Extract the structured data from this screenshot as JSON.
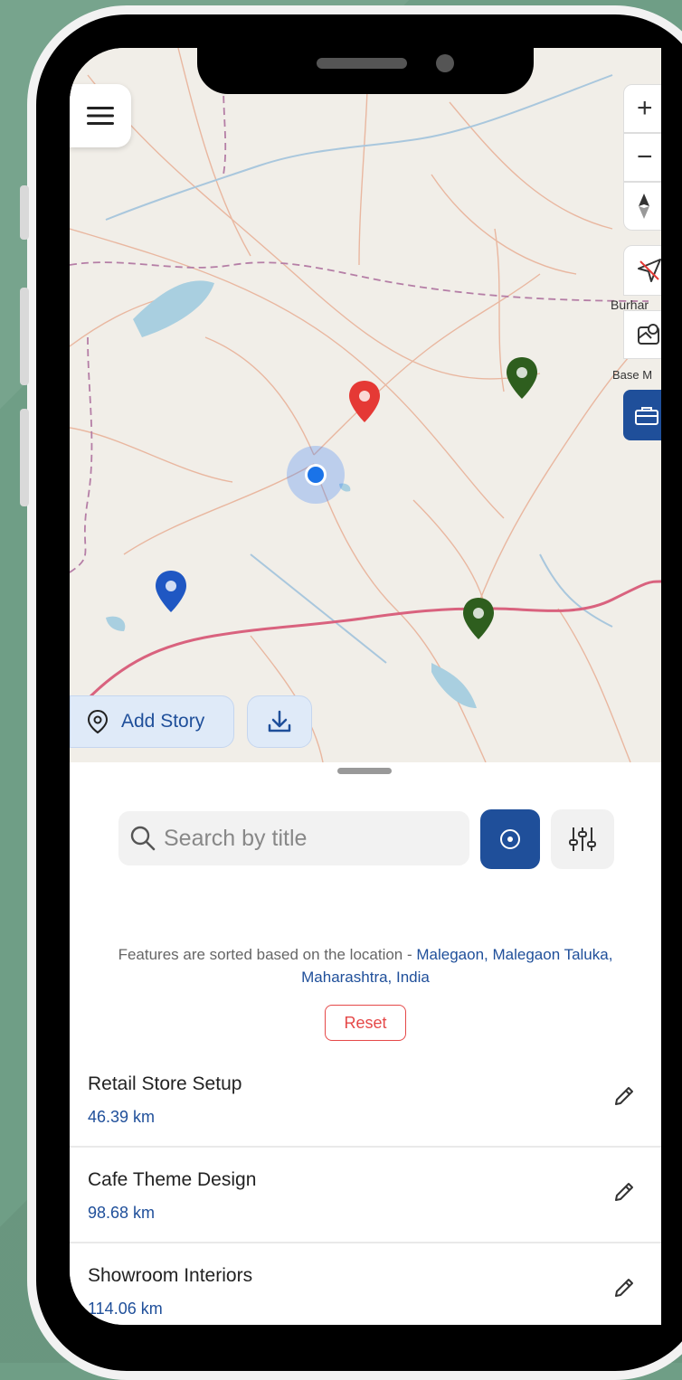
{
  "map": {
    "label_city": "Burhar",
    "label_base": "Base M",
    "add_story_label": "Add Story"
  },
  "search": {
    "placeholder": "Search by title",
    "value": ""
  },
  "sort_note": {
    "prefix": "Features are sorted based on the location - ",
    "location": "Malegaon, Malegaon Taluka, Maharashtra, India"
  },
  "reset_label": "Reset",
  "features": [
    {
      "title": "Retail Store Setup",
      "distance": "46.39 km"
    },
    {
      "title": "Cafe Theme Design",
      "distance": "98.68 km"
    },
    {
      "title": "Showroom Interiors",
      "distance": "114.06 km"
    }
  ],
  "colors": {
    "accent": "#1f4f9a",
    "reset": "#e54848",
    "marker_red": "#e53935",
    "marker_green": "#2e5e1e",
    "marker_blue": "#1f57c3"
  }
}
